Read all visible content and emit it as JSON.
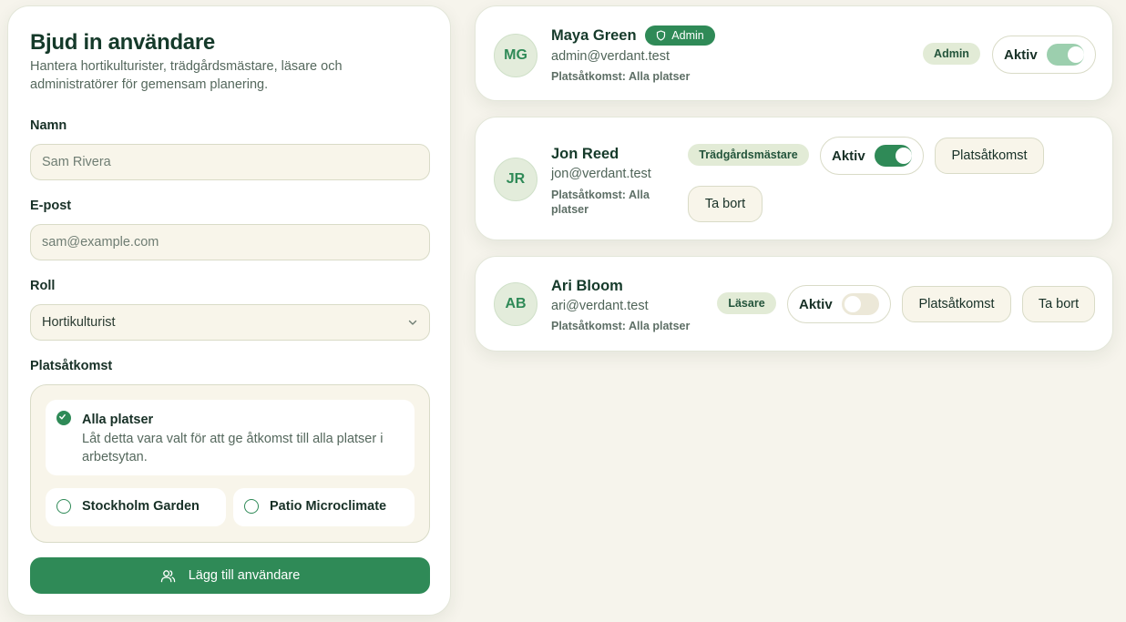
{
  "invite": {
    "title": "Bjud in användare",
    "subtitle": "Hantera hortikulturister, trädgårdsmästare, läsare och administratörer för gemensam planering.",
    "name_label": "Namn",
    "name_placeholder": "Sam Rivera",
    "email_label": "E-post",
    "email_placeholder": "sam@example.com",
    "role_label": "Roll",
    "role_value": "Hortikulturist",
    "access_label": "Platsåtkomst",
    "access_options": [
      {
        "label": "Alla platser",
        "desc": "Låt detta vara valt för att ge åtkomst till alla platser i arbetsytan.",
        "checked": true
      },
      {
        "label": "Stockholm Garden",
        "checked": false
      },
      {
        "label": "Patio Microclimate",
        "checked": false
      }
    ],
    "add_button": "Lägg till användare"
  },
  "users": [
    {
      "initials": "MG",
      "name": "Maya Green",
      "admin_badge": "Admin",
      "email": "admin@verdant.test",
      "access": "Platsåtkomst: Alla platser",
      "role": "Admin",
      "toggle_label": "Aktiv",
      "active": true
    },
    {
      "initials": "JR",
      "name": "Jon Reed",
      "email": "jon@verdant.test",
      "access": "Platsåtkomst: Alla platser",
      "role": "Trädgårdsmästare",
      "toggle_label": "Aktiv",
      "active": true,
      "access_button": "Platsåtkomst",
      "remove_button": "Ta bort"
    },
    {
      "initials": "AB",
      "name": "Ari Bloom",
      "email": "ari@verdant.test",
      "access": "Platsåtkomst: Alla platser",
      "role": "Läsare",
      "toggle_label": "Aktiv",
      "active": false,
      "access_button": "Platsåtkomst",
      "remove_button": "Ta bort"
    }
  ],
  "colors": {
    "accent": "#2f8a57",
    "background": "#f6f4ec",
    "pill": "#e2ebd6"
  },
  "icons": [
    "check-icon",
    "users-icon",
    "shield-icon",
    "chevron-down-icon"
  ]
}
